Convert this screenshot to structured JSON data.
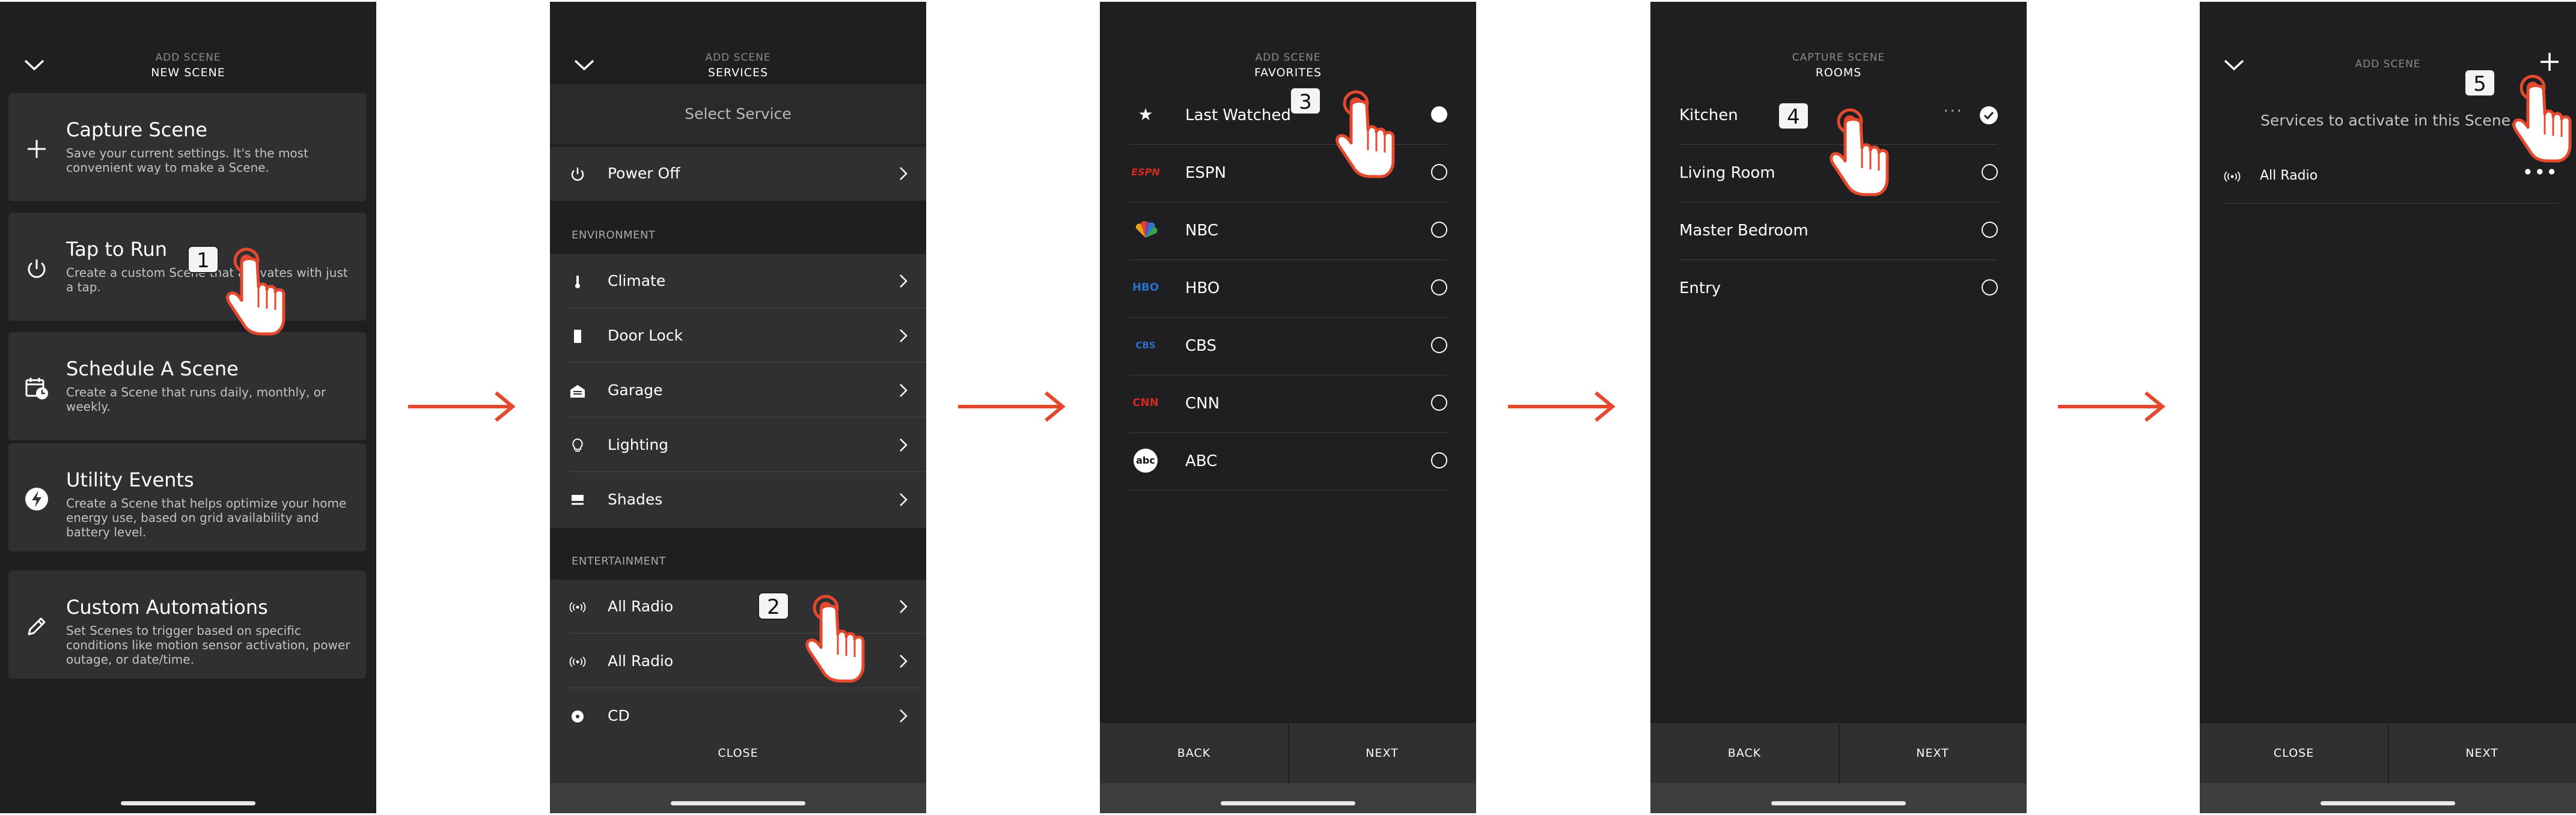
{
  "screens": {
    "s1": {
      "header_sub": "ADD SCENE",
      "header_title": "NEW SCENE",
      "cards": [
        {
          "title": "Capture Scene",
          "desc": "Save your current settings. It's the most convenient way to make a Scene.",
          "icon": "plus-icon"
        },
        {
          "title": "Tap to Run",
          "desc": "Create a custom Scene that activates with just a tap.",
          "icon": "power-icon"
        },
        {
          "title": "Schedule A Scene",
          "desc": "Create a Scene that runs daily, monthly, or weekly.",
          "icon": "calendar-clock-icon"
        },
        {
          "title": "Utility Events",
          "desc": "Create a Scene that helps optimize your home energy use, based on grid availability and battery level.",
          "icon": "lightning-icon"
        },
        {
          "title": "Custom Automations",
          "desc": "Set Scenes to trigger based on specific conditions like motion sensor activation, power outage, or date/time.",
          "icon": "pencil-icon"
        }
      ]
    },
    "s2": {
      "header_sub": "ADD SCENE",
      "header_title": "SERVICES",
      "select_label": "Select Service",
      "power_off": "Power Off",
      "section_environment": "ENVIRONMENT",
      "environment": [
        "Climate",
        "Door Lock",
        "Garage",
        "Lighting",
        "Shades"
      ],
      "section_entertainment": "ENTERTAINMENT",
      "entertainment": [
        "All Radio",
        "All Radio",
        "CD"
      ],
      "close": "CLOSE"
    },
    "s3": {
      "header_sub": "ADD SCENE",
      "header_title": "FAVORITES",
      "items": [
        {
          "label": "Last Watched",
          "logo": "★",
          "selected": true
        },
        {
          "label": "ESPN",
          "logo": "ESPN",
          "selected": false
        },
        {
          "label": "NBC",
          "logo": "NBC",
          "selected": false
        },
        {
          "label": "HBO",
          "logo": "HBO",
          "selected": false
        },
        {
          "label": "CBS",
          "logo": "CBS",
          "selected": false
        },
        {
          "label": "CNN",
          "logo": "CNN",
          "selected": false
        },
        {
          "label": "ABC",
          "logo": "abc",
          "selected": false
        }
      ],
      "back": "BACK",
      "next": "NEXT"
    },
    "s4": {
      "header_sub": "CAPTURE SCENE",
      "header_title": "ROOMS",
      "rooms": [
        {
          "label": "Kitchen",
          "checked": true
        },
        {
          "label": "Living Room",
          "checked": false
        },
        {
          "label": "Master Bedroom",
          "checked": false
        },
        {
          "label": "Entry",
          "checked": false
        }
      ],
      "back": "BACK",
      "next": "NEXT"
    },
    "s5": {
      "header_sub": "ADD SCENE",
      "message": "Services to activate in this Scene.",
      "service": "All Radio",
      "close": "CLOSE",
      "next": "NEXT"
    }
  },
  "callouts": [
    "1",
    "2",
    "3",
    "4",
    "5"
  ],
  "colors": {
    "screen_bg": "#1f1f21",
    "card_bg": "#303033",
    "arrow": "#e4492e",
    "hand": "#e4492e"
  }
}
